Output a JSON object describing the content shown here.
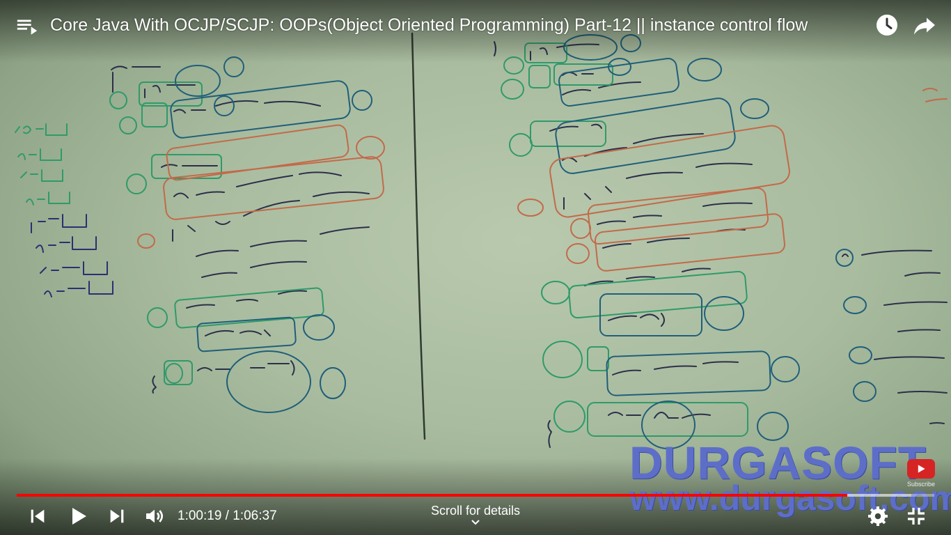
{
  "video": {
    "title": "Core Java With OCJP/SCJP: OOPs(Object Oriented Programming) Part-12 || instance control flow",
    "current_time": "1:00:19",
    "duration": "1:06:37",
    "time_separator": " / ",
    "progress": 0.9054,
    "buffered": 0.975
  },
  "watermark": {
    "brand": "DURGASOFT",
    "url": "www.durgasoft.com",
    "subscribe_label": "Subscribe"
  },
  "controls": {
    "scroll_hint": "Scroll for details"
  },
  "icons": {
    "playlist": "playlist-icon",
    "watch_later": "clock-icon",
    "share": "share-arrow-icon",
    "previous": "skip-previous-icon",
    "play": "play-icon",
    "next": "skip-next-icon",
    "volume": "volume-icon",
    "settings": "gear-icon",
    "exit_fullscreen": "exit-fullscreen-icon",
    "chevron": "chevron-down-icon"
  },
  "colors": {
    "progress": "#ff0000",
    "watermark": "#5d6ec9",
    "board": "#b9c9ae"
  }
}
